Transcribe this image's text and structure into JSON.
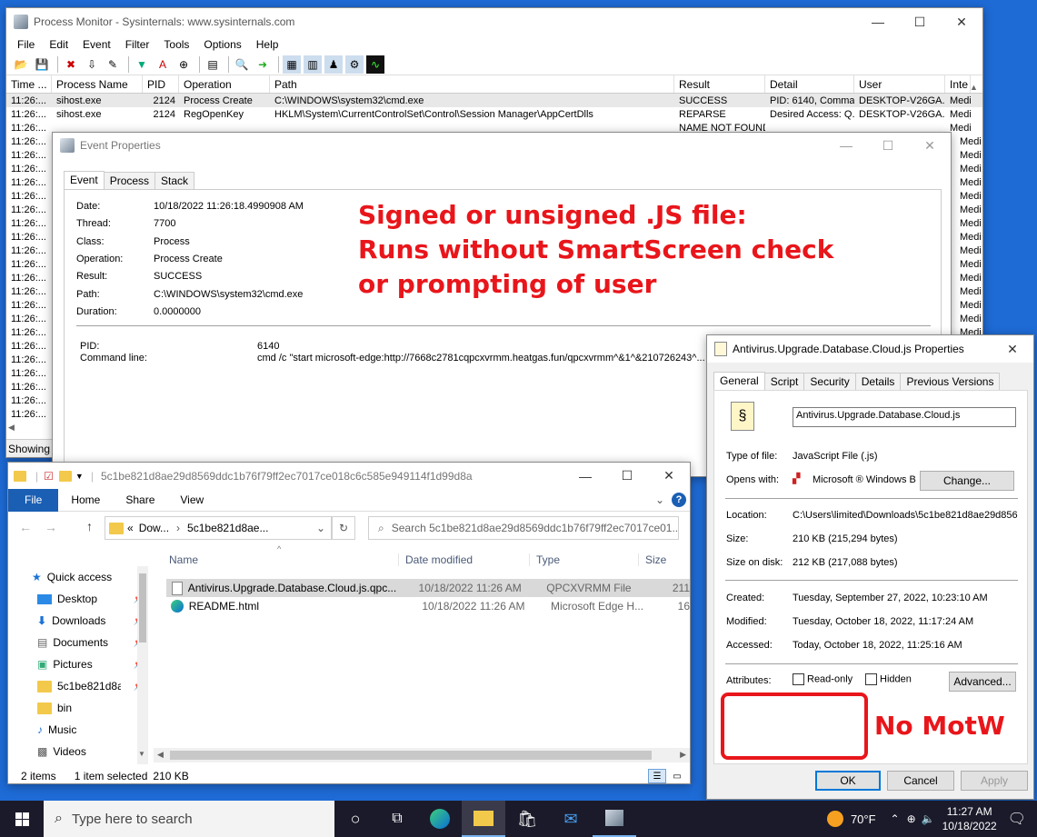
{
  "procmon": {
    "title": "Process Monitor - Sysinternals: www.sysinternals.com",
    "menu": [
      "File",
      "Edit",
      "Event",
      "Filter",
      "Tools",
      "Options",
      "Help"
    ],
    "columns": [
      "Time ...",
      "Process Name",
      "PID",
      "Operation",
      "Path",
      "Result",
      "Detail",
      "User",
      "Inte"
    ],
    "rows": [
      {
        "time": "11:26:...",
        "process": "sihost.exe",
        "pid": "2124",
        "operation": "Process Create",
        "path": "C:\\WINDOWS\\system32\\cmd.exe",
        "result": "SUCCESS",
        "detail": "PID: 6140, Comma...",
        "user": "DESKTOP-V26GA...",
        "integrity": "Medi"
      },
      {
        "time": "11:26:...",
        "process": "sihost.exe",
        "pid": "2124",
        "operation": "RegOpenKey",
        "path": "HKLM\\System\\CurrentControlSet\\Control\\Session Manager\\AppCertDlls",
        "result": "REPARSE",
        "detail": "Desired Access: Q...",
        "user": "DESKTOP-V26GA...",
        "integrity": "Medi"
      },
      {
        "time": "11:26:...",
        "process": "",
        "pid": "",
        "operation": "",
        "path": "",
        "result": "NAME NOT FOUND",
        "detail": "",
        "user": "",
        "integrity": "Medi"
      }
    ],
    "time_stub": "11:26:...",
    "integrity_stub": "Medi",
    "status": "Showing"
  },
  "event_props": {
    "title": "Event Properties",
    "tabs": [
      "Event",
      "Process",
      "Stack"
    ],
    "fields": [
      {
        "label": "Date:",
        "value": "10/18/2022 11:26:18.4990908 AM"
      },
      {
        "label": "Thread:",
        "value": "7700"
      },
      {
        "label": "Class:",
        "value": "Process"
      },
      {
        "label": "Operation:",
        "value": "Process Create"
      },
      {
        "label": "Result:",
        "value": "SUCCESS"
      },
      {
        "label": "Path:",
        "value": "C:\\WINDOWS\\system32\\cmd.exe"
      },
      {
        "label": "Duration:",
        "value": "0.0000000"
      }
    ],
    "pid_label": "PID:",
    "pid_value": "6140",
    "cmd_label": "Command line:",
    "cmd_value": "cmd /c \"start microsoft-edge:http://7668c2781cqpcxvrmm.heatgas.fun/qpcxvrmm^&1^&210726243^..."
  },
  "annotations": {
    "line1": "Signed or unsigned .JS file:",
    "line2": "Runs without SmartScreen check",
    "line3": "or prompting of user",
    "motw": "No MotW"
  },
  "explorer": {
    "title": "5c1be821d8ae29d8569ddc1b76f79ff2ec7017ce018c6c585e949114f1d99d8a",
    "ribbon": [
      "File",
      "Home",
      "Share",
      "View"
    ],
    "crumb_prefix": "«",
    "crumb_1": "Dow...",
    "crumb_2": "5c1be821d8ae...",
    "search_placeholder": "Search 5c1be821d8ae29d8569ddc1b76f79ff2ec7017ce01...",
    "columns": [
      "Name",
      "Date modified",
      "Type",
      "Size"
    ],
    "nav": [
      {
        "label": "Quick access",
        "pinned": false
      },
      {
        "label": "Desktop",
        "pinned": true
      },
      {
        "label": "Downloads",
        "pinned": true
      },
      {
        "label": "Documents",
        "pinned": true
      },
      {
        "label": "Pictures",
        "pinned": true
      },
      {
        "label": "5c1be821d8ae",
        "pinned": true
      },
      {
        "label": "bin",
        "pinned": false
      },
      {
        "label": "Music",
        "pinned": false
      },
      {
        "label": "Videos",
        "pinned": false
      }
    ],
    "files": [
      {
        "name": "Antivirus.Upgrade.Database.Cloud.js.qpc...",
        "date": "10/18/2022 11:26 AM",
        "type": "QPCXVRMM File",
        "size": "211"
      },
      {
        "name": "README.html",
        "date": "10/18/2022 11:26 AM",
        "type": "Microsoft Edge H...",
        "size": "16"
      }
    ],
    "status_items": "2 items",
    "status_selected": "1 item selected",
    "status_size": "210 KB"
  },
  "props": {
    "title": "Antivirus.Upgrade.Database.Cloud.js Properties",
    "tabs": [
      "General",
      "Script",
      "Security",
      "Details",
      "Previous Versions"
    ],
    "filename": "Antivirus.Upgrade.Database.Cloud.js",
    "type_label": "Type of file:",
    "type_value": "JavaScript File (.js)",
    "opens_label": "Opens with:",
    "opens_value": "Microsoft ® Windows B",
    "change_label": "Change...",
    "location_label": "Location:",
    "location_value": "C:\\Users\\limited\\Downloads\\5c1be821d8ae29d856",
    "size_label": "Size:",
    "size_value": "210 KB (215,294 bytes)",
    "disk_label": "Size on disk:",
    "disk_value": "212 KB (217,088 bytes)",
    "created_label": "Created:",
    "created_value": "Tuesday, September 27, 2022, 10:23:10 AM",
    "modified_label": "Modified:",
    "modified_value": "Tuesday, October 18, 2022, 11:17:24 AM",
    "accessed_label": "Accessed:",
    "accessed_value": "Today, October 18, 2022, 11:25:16 AM",
    "attr_label": "Attributes:",
    "readonly_label": "Read-only",
    "hidden_label": "Hidden",
    "advanced_label": "Advanced...",
    "ok": "OK",
    "cancel": "Cancel",
    "apply": "Apply"
  },
  "taskbar": {
    "search_placeholder": "Type here to search",
    "weather": "70°F",
    "time": "11:27 AM",
    "date": "10/18/2022"
  }
}
